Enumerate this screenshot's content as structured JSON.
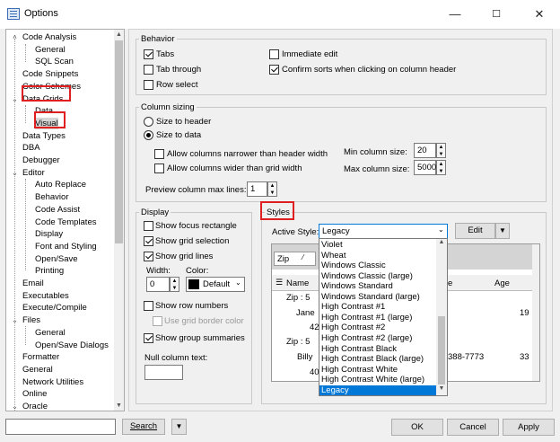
{
  "window": {
    "title": "Options",
    "min": "—",
    "max": "☐",
    "close": "✕"
  },
  "tree": {
    "items": [
      {
        "label": "Code Analysis",
        "level": 1,
        "toggle": "^"
      },
      {
        "label": "General",
        "level": 2
      },
      {
        "label": "SQL Scan",
        "level": 2
      },
      {
        "label": "Code Snippets",
        "level": 1
      },
      {
        "label": "Color Schemes",
        "level": 1
      },
      {
        "label": "Data Grids",
        "level": 1,
        "toggle": "v"
      },
      {
        "label": "Data",
        "level": 2
      },
      {
        "label": "Visual",
        "level": 2,
        "selected": true
      },
      {
        "label": "Data Types",
        "level": 1
      },
      {
        "label": "DBA",
        "level": 1
      },
      {
        "label": "Debugger",
        "level": 1
      },
      {
        "label": "Editor",
        "level": 1,
        "toggle": "v"
      },
      {
        "label": "Auto Replace",
        "level": 2
      },
      {
        "label": "Behavior",
        "level": 2
      },
      {
        "label": "Code Assist",
        "level": 2
      },
      {
        "label": "Code Templates",
        "level": 2
      },
      {
        "label": "Display",
        "level": 2
      },
      {
        "label": "Font and Styling",
        "level": 2
      },
      {
        "label": "Open/Save",
        "level": 2
      },
      {
        "label": "Printing",
        "level": 2
      },
      {
        "label": "Email",
        "level": 1
      },
      {
        "label": "Executables",
        "level": 1
      },
      {
        "label": "Execute/Compile",
        "level": 1
      },
      {
        "label": "Files",
        "level": 1,
        "toggle": "v"
      },
      {
        "label": "General",
        "level": 2
      },
      {
        "label": "Open/Save Dialogs",
        "level": 2
      },
      {
        "label": "Formatter",
        "level": 1
      },
      {
        "label": "General",
        "level": 1
      },
      {
        "label": "Network Utilities",
        "level": 1
      },
      {
        "label": "Online",
        "level": 1
      },
      {
        "label": "Oracle",
        "level": 1,
        "toggle": "v"
      }
    ]
  },
  "behavior": {
    "title": "Behavior",
    "tabs": "Tabs",
    "tab_through": "Tab through",
    "row_select": "Row select",
    "immediate_edit": "Immediate edit",
    "confirm_sorts": "Confirm sorts when clicking on column header"
  },
  "sizing": {
    "title": "Column sizing",
    "size_header": "Size to header",
    "size_data": "Size to data",
    "allow_narrower": "Allow columns narrower than header width",
    "allow_wider": "Allow columns wider than grid width",
    "min_label": "Min column size:",
    "min_value": "20",
    "max_label": "Max column size:",
    "max_value": "5000",
    "preview_label": "Preview column max lines:",
    "preview_value": "1"
  },
  "display": {
    "title": "Display",
    "focus_rect": "Show focus rectangle",
    "grid_selection": "Show grid selection",
    "grid_lines": "Show grid lines",
    "width_label": "Width:",
    "width_value": "0",
    "color_label": "Color:",
    "color_value": "Default",
    "row_numbers": "Show row numbers",
    "use_border_color": "Use grid border color",
    "group_summaries": "Show group summaries",
    "null_text_label": "Null column text:",
    "null_text_value": ""
  },
  "styles": {
    "title": "Styles",
    "active_label": "Active Style:",
    "active_value": "Legacy",
    "edit_label": "Edit",
    "options": [
      "Violet",
      "Wheat",
      "Windows Classic",
      "Windows Classic (large)",
      "Windows Standard",
      "Windows Standard (large)",
      "High Contrast #1",
      "High Contrast #1 (large)",
      "High Contrast #2",
      "High Contrast #2 (large)",
      "High Contrast Black",
      "High Contrast Black (large)",
      "High Contrast White",
      "High Contrast White (large)",
      "Legacy"
    ],
    "grid": {
      "group_col": "Zip",
      "name_col": "Name",
      "e_col": "e",
      "age_col": "Age",
      "group1": "Zip : 5",
      "row1_name": "Jane",
      "row1_age": "19",
      "row1_num": "42",
      "group2": "Zip : 5",
      "row2_name": "Billy",
      "row2_phone": "388-7773",
      "row2_age": "33",
      "row2_num": "40"
    }
  },
  "footer": {
    "search": "Search",
    "ok": "OK",
    "cancel": "Cancel",
    "apply": "Apply",
    "search_value": ""
  }
}
